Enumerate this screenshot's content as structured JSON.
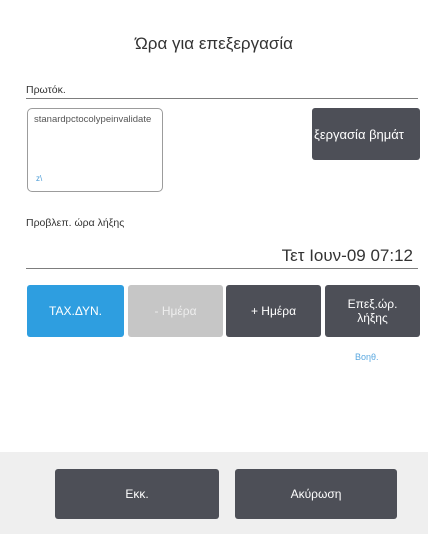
{
  "dialog": {
    "title": "Ώρα για επεξεργασία"
  },
  "protocol": {
    "label": "Πρωτόκ.",
    "value": "stanardpctocolypeinvalidate",
    "corner_mark": "z\\"
  },
  "process_button": {
    "label": "ξεργασία βημάτ"
  },
  "end_time": {
    "label": "Προβλεπ. ώρα λήξης",
    "value": "Τετ Ιουν-09 07:12"
  },
  "day_buttons": {
    "asap": "ΤΑΧ.ΔΥΝ.",
    "minus_day": "- Ημέρα",
    "plus_day": "+ Ημέρα",
    "select_end_time": "Επεξ.ώρ. λήξης"
  },
  "help": {
    "label": "Βοηθ."
  },
  "footer": {
    "ok": "Εκκ.",
    "cancel": "Ακύρωση"
  },
  "colors": {
    "accent_blue": "#2e9ee0",
    "dark_button": "#4d4f57",
    "disabled_button": "#c6c6c6",
    "footer_bg": "#efefef"
  }
}
